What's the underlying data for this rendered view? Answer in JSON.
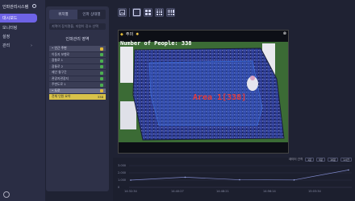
{
  "app": {
    "title": "인파관리시스템"
  },
  "leftnav": {
    "items": [
      {
        "label": "대시보드",
        "active": true
      },
      {
        "label": "모니터링",
        "active": false
      },
      {
        "label": "설정",
        "active": false
      },
      {
        "label": "관리",
        "active": false,
        "has_submenu": true
      }
    ]
  },
  "panel": {
    "tabs": [
      "위치별",
      "인파 상태별"
    ],
    "search_placeholder": "지역이 장치명을, 지원이 장소 선택",
    "area_title": "인파관리 영역",
    "areas": [
      {
        "label": "• 인근 주변",
        "status": "amber",
        "group": true
      },
      {
        "label": "  이동지 보행로",
        "status": "green"
      },
      {
        "label": "  광통로 1",
        "status": "green"
      },
      {
        "label": "  광통로 2",
        "status": "green"
      },
      {
        "label": "  제안 통구간",
        "status": "green"
      },
      {
        "label": "  관광지관광지",
        "status": "green"
      },
      {
        "label": "  주변도로 1",
        "status": "green"
      },
      {
        "label": "• 도로",
        "status": "amber",
        "group": true,
        "selected": true
      }
    ],
    "total": {
      "label": "전체 인원 요약",
      "value": "338"
    }
  },
  "toolbar": {
    "buttons": [
      "layout-1",
      "layout-2x2",
      "layout-3x3",
      "layout-4x4"
    ]
  },
  "camera": {
    "header_label": "주의",
    "people_count_text": "Number of People: 338",
    "area_text": "Area 1[338]",
    "colors": {
      "alert": "#e23b3b",
      "area_fill": "#3b6bd6"
    }
  },
  "chart": {
    "legend_label": "데이터 간격",
    "legend_buttons": [
      "1분",
      "5분",
      "10분",
      "1시간"
    ],
    "yticks": [
      "3.000",
      "2.000",
      "1.000",
      "0"
    ],
    "xticks": [
      "14:32:34",
      "14:40:27",
      "14:48:21",
      "14:56:14",
      "15:03:34"
    ]
  },
  "chart_data": {
    "type": "line",
    "title": "",
    "xlabel": "",
    "ylabel": "",
    "x": [
      "14:32:34",
      "14:40:27",
      "14:48:21",
      "14:56:14",
      "15:03:34"
    ],
    "series": [
      {
        "name": "",
        "values": [
          1000,
          1400,
          1050,
          1020,
          2400
        ]
      }
    ],
    "ylim": [
      0,
      3000
    ]
  }
}
